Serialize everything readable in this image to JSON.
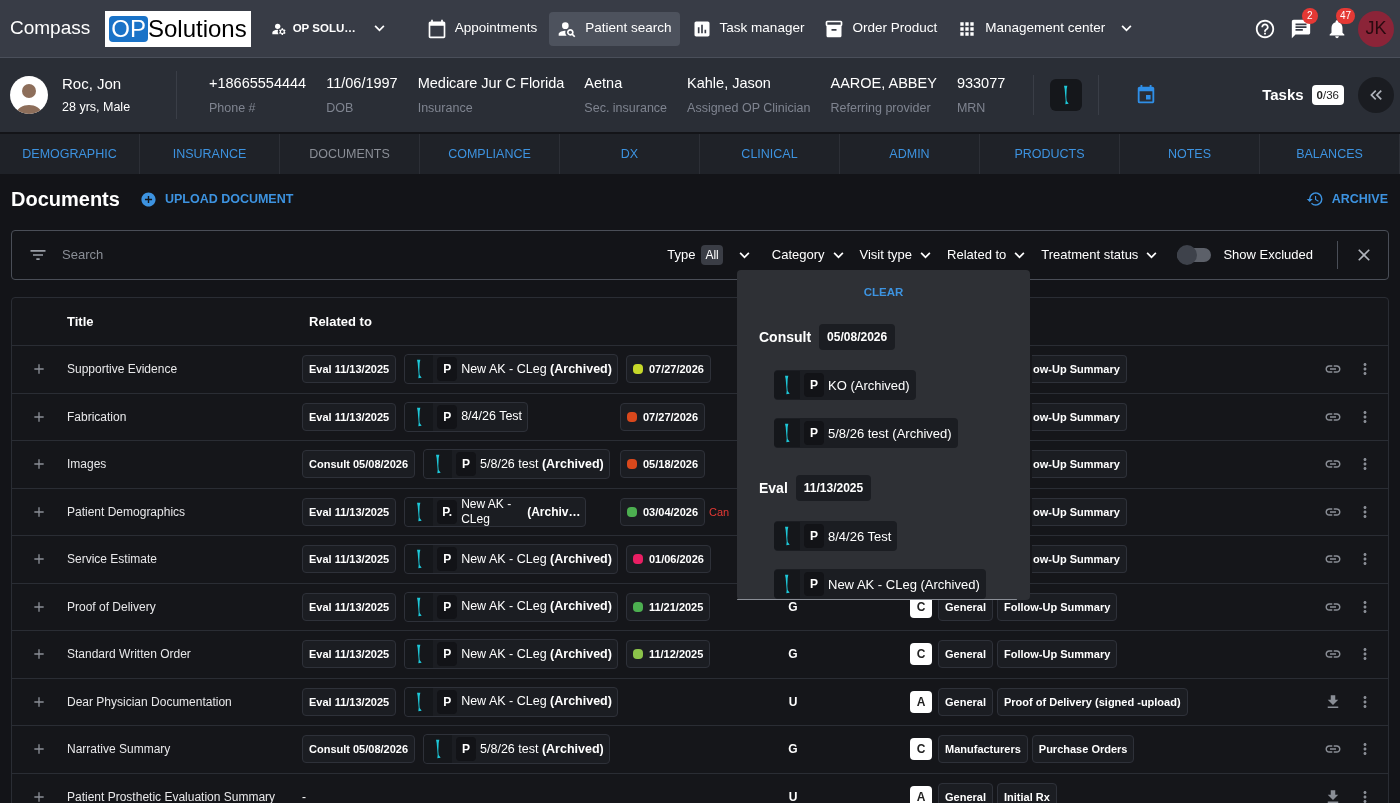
{
  "nav": {
    "brand": "Compass",
    "logo": {
      "left": "OP",
      "right": "Solutions"
    },
    "org": "OP SOLU…",
    "items": [
      {
        "label": "Appointments",
        "selected": false,
        "dropdown": false
      },
      {
        "label": "Patient search",
        "selected": true,
        "dropdown": false
      },
      {
        "label": "Task manager",
        "selected": false,
        "dropdown": false
      },
      {
        "label": "Order Product",
        "selected": false,
        "dropdown": false
      },
      {
        "label": "Management center",
        "selected": false,
        "dropdown": true
      }
    ],
    "messages_badge": "2",
    "notifications_badge": "47",
    "avatar": "JK"
  },
  "patient": {
    "name": "Roc, Jon",
    "age_sex": "28 yrs, Male",
    "fields": [
      {
        "value": "+18665554444",
        "label": "Phone #"
      },
      {
        "value": "11/06/1997",
        "label": "DOB"
      },
      {
        "value": "Medicare Jur C Florida",
        "label": "Insurance"
      },
      {
        "value": "Aetna",
        "label": "Sec. insurance"
      },
      {
        "value": "Kahle, Jason",
        "label": "Assigned OP Clinician"
      },
      {
        "value": "AAROE, ABBEY",
        "label": "Referring provider"
      },
      {
        "value": "933077",
        "label": "MRN"
      }
    ],
    "tasks": {
      "label": "Tasks",
      "done": "0",
      "total": "/36"
    }
  },
  "tabs": [
    {
      "label": "DEMOGRAPHIC",
      "selected": false
    },
    {
      "label": "INSURANCE",
      "selected": false
    },
    {
      "label": "DOCUMENTS",
      "selected": true
    },
    {
      "label": "COMPLIANCE",
      "selected": false
    },
    {
      "label": "DX",
      "selected": false
    },
    {
      "label": "CLINICAL",
      "selected": false
    },
    {
      "label": "ADMIN",
      "selected": false
    },
    {
      "label": "PRODUCTS",
      "selected": false
    },
    {
      "label": "NOTES",
      "selected": false
    },
    {
      "label": "BALANCES",
      "selected": false
    }
  ],
  "documents": {
    "title": "Documents",
    "upload": "UPLOAD DOCUMENT",
    "archive": "ARCHIVE"
  },
  "filters": {
    "search_placeholder": "Search",
    "type_label": "Type",
    "type_value": "All",
    "dropdowns": [
      "Category",
      "Visit type",
      "Related to",
      "Treatment status"
    ],
    "show_excluded": {
      "label": "Show Excluded",
      "on": false
    }
  },
  "table": {
    "columns": [
      "Title",
      "Related to"
    ],
    "rows": [
      {
        "title": "Supportive Evidence",
        "visit": "Eval 11/13/2025",
        "product": {
          "code": "P",
          "name": "New AK - CLeg",
          "suffix": "(Archived)",
          "wrap": false
        },
        "date": {
          "color": "#c6d82a",
          "text": "07/27/2026"
        },
        "partial_tag": "ow-Up Summary",
        "kind": "link"
      },
      {
        "title": "Fabrication",
        "visit": "Eval 11/13/2025",
        "product": {
          "code": "P",
          "name": "8/4/26 Test",
          "wrap": false
        },
        "date": {
          "color": "#d9481c",
          "text": "07/27/2026"
        },
        "partial_tag": "ow-Up Summary",
        "kind": "link"
      },
      {
        "title": "Images",
        "visit": "Consult 05/08/2026",
        "product": {
          "code": "P",
          "name": "5/8/26 test",
          "suffix": "(Archived)",
          "wrap": false
        },
        "date": {
          "color": "#d9481c",
          "text": "05/18/2026"
        },
        "partial_tag": "ow-Up Summary",
        "kind": "link"
      },
      {
        "title": "Patient Demographics",
        "visit": "Eval 11/13/2025",
        "product": {
          "code": "P.",
          "name": "New AK - CLeg",
          "suffix": "(Archiv…",
          "wrap": true
        },
        "date": {
          "color": "#4caf50",
          "text": "03/04/2026"
        },
        "status": "Can",
        "partial_tag": "ow-Up Summary",
        "kind": "link"
      },
      {
        "title": "Service Estimate",
        "visit": "Eval 11/13/2025",
        "product": {
          "code": "P",
          "name": "New AK - CLeg",
          "suffix": "(Archived)",
          "wrap": false
        },
        "date": {
          "color": "#e91e63",
          "text": "01/06/2026"
        },
        "partial_tag": "ow-Up Summary",
        "kind": "link"
      },
      {
        "title": "Proof of Delivery",
        "visit": "Eval 11/13/2025",
        "product": {
          "code": "P",
          "name": "New AK - CLeg",
          "suffix": "(Archived)",
          "wrap": false
        },
        "date": {
          "color": "#4caf50",
          "text": "11/21/2025"
        },
        "type_code": "G",
        "badge": "C",
        "category": "General",
        "subcategory": "Follow-Up Summary",
        "kind": "link"
      },
      {
        "title": "Standard Written Order",
        "visit": "Eval 11/13/2025",
        "product": {
          "code": "P",
          "name": "New AK - CLeg",
          "suffix": "(Archived)",
          "wrap": false
        },
        "date": {
          "color": "#8bc34a",
          "text": "11/12/2025"
        },
        "type_code": "G",
        "badge": "C",
        "category": "General",
        "subcategory": "Follow-Up Summary",
        "kind": "link"
      },
      {
        "title": "Dear Physician Documentation",
        "visit": "Eval 11/13/2025",
        "product": {
          "code": "P",
          "name": "New AK - CLeg",
          "suffix": "(Archived)",
          "wrap": false
        },
        "type_code": "U",
        "badge": "A",
        "category": "General",
        "subcategory": "Proof of Delivery (signed -upload)",
        "kind": "download"
      },
      {
        "title": "Narrative Summary",
        "visit": "Consult 05/08/2026",
        "product": {
          "code": "P",
          "name": "5/8/26 test",
          "suffix": "(Archived)",
          "wrap": false
        },
        "type_code": "G",
        "badge": "C",
        "category": "Manufacturers",
        "subcategory": "Purchase Orders",
        "kind": "link"
      },
      {
        "title": "Patient Prosthetic Evaluation Summary",
        "related_text": "-",
        "type_code": "U",
        "badge": "A",
        "category": "General",
        "subcategory": "Initial Rx",
        "kind": "download"
      }
    ]
  },
  "popover": {
    "clear": "CLEAR",
    "groups": [
      {
        "label": "Consult",
        "date": "05/08/2026",
        "items": [
          {
            "code": "P",
            "name": "KO (Archived)"
          },
          {
            "code": "P",
            "name": "5/8/26 test (Archived)"
          }
        ]
      },
      {
        "label": "Eval",
        "date": "11/13/2025",
        "items": [
          {
            "code": "P",
            "name": "8/4/26 Test"
          },
          {
            "code": "P",
            "name": "New AK - CLeg (Archived)"
          }
        ]
      }
    ]
  }
}
